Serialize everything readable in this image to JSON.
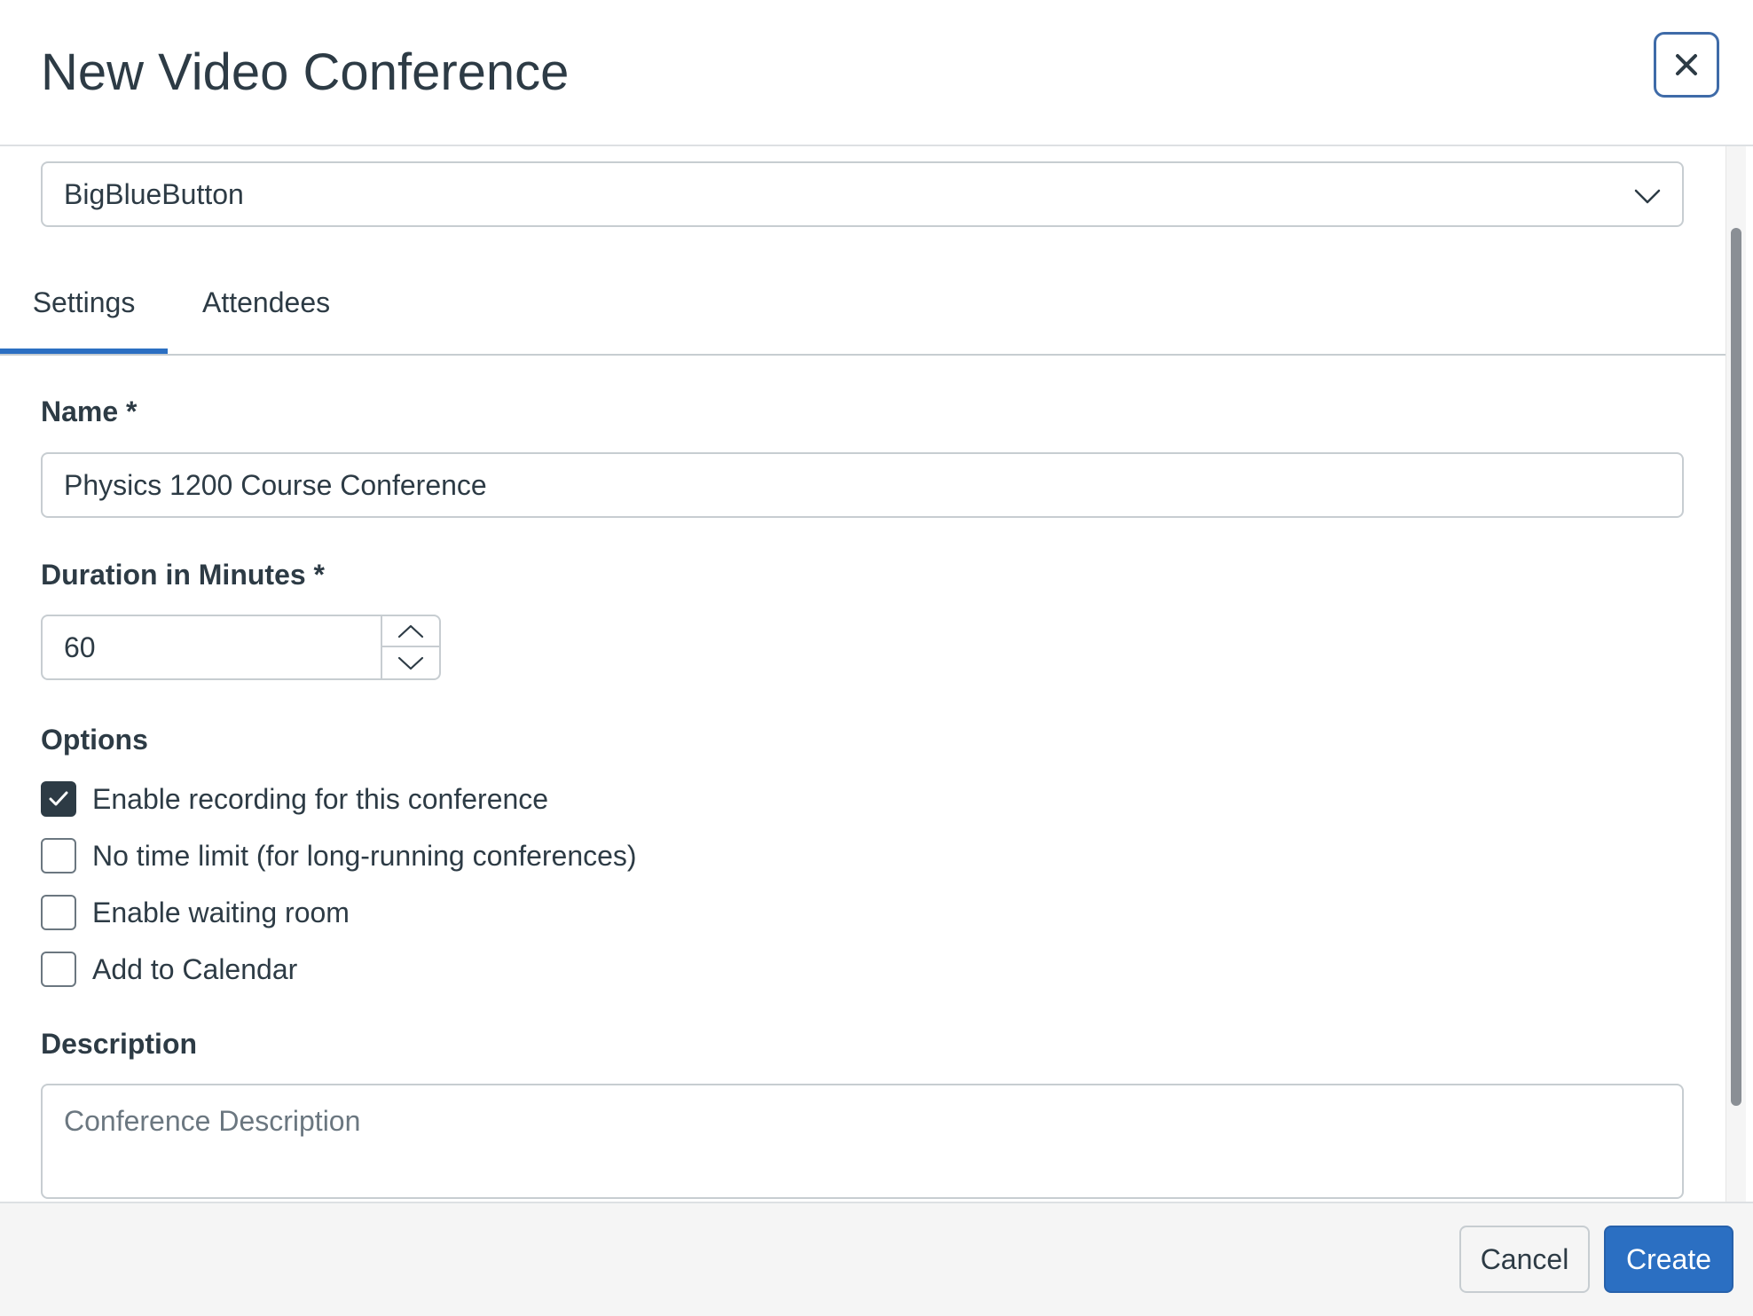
{
  "dialog": {
    "title": "New Video Conference",
    "close_label": "×"
  },
  "provider_select": {
    "value": "BigBlueButton"
  },
  "tabs": [
    {
      "label": "Settings",
      "active": true
    },
    {
      "label": "Attendees",
      "active": false
    }
  ],
  "form": {
    "name": {
      "label": "Name *",
      "value": "Physics 1200 Course Conference"
    },
    "duration": {
      "label": "Duration in Minutes *",
      "value": "60"
    },
    "options": {
      "label": "Options",
      "items": [
        {
          "label": "Enable recording for this conference",
          "checked": true
        },
        {
          "label": "No time limit (for long-running conferences)",
          "checked": false
        },
        {
          "label": "Enable waiting room",
          "checked": false
        },
        {
          "label": "Add to Calendar",
          "checked": false
        }
      ]
    },
    "description": {
      "label": "Description",
      "placeholder": "Conference Description",
      "value": ""
    }
  },
  "footer": {
    "cancel_label": "Cancel",
    "create_label": "Create"
  },
  "colors": {
    "primary": "#2b6fc2",
    "text": "#2d3b45",
    "border": "#c7cdd1",
    "footer_bg": "#f5f5f5"
  },
  "icons": {
    "close": "close-icon",
    "select_chevron": "chevron-down-icon",
    "stepper_up": "chevron-up-icon",
    "stepper_down": "chevron-down-icon",
    "checkmark": "checkmark-icon"
  }
}
